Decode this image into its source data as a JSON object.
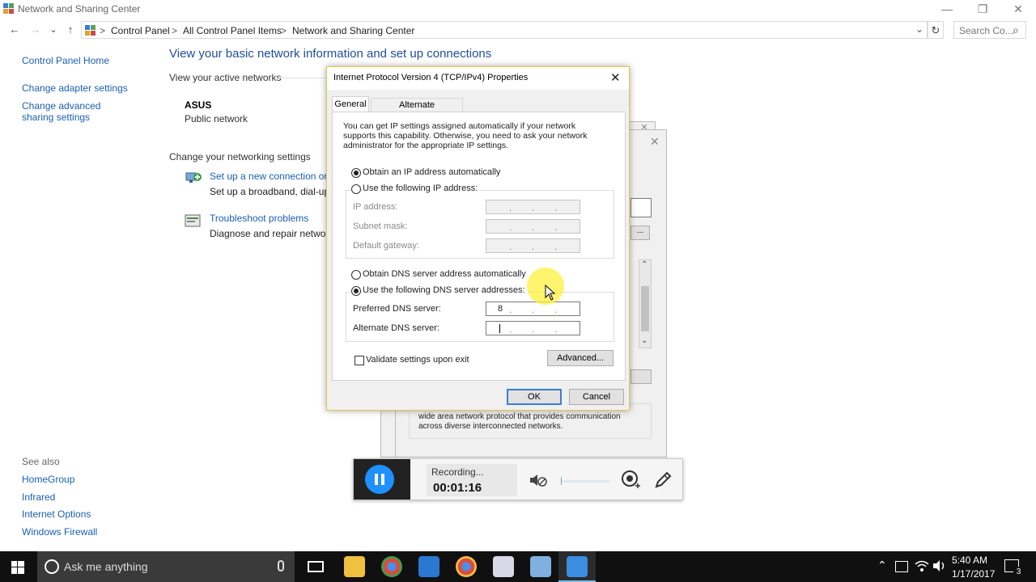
{
  "window": {
    "title": "Network and Sharing Center",
    "minimize": "—",
    "restore": "❐",
    "close": "✕"
  },
  "address": {
    "back": "←",
    "forward": "→",
    "dropdown": "⌄",
    "up": "↑",
    "breadcrumb": [
      "Control Panel",
      "All Control Panel Items",
      "Network and Sharing Center"
    ],
    "separator": ">",
    "refresh": "↻",
    "search_placeholder": "Search Co...",
    "search_icon": "⌕"
  },
  "left_pane": {
    "links": [
      "Control Panel Home",
      "Change adapter settings",
      "Change advanced sharing settings"
    ],
    "see_also_label": "See also",
    "see_also": [
      "HomeGroup",
      "Infrared",
      "Internet Options",
      "Windows Firewall"
    ]
  },
  "main": {
    "heading": "View your basic network information and set up connections",
    "active_networks_label": "View your active networks",
    "network_name": "ASUS",
    "network_type": "Public network",
    "change_settings_label": "Change your networking settings",
    "tasks": [
      {
        "title": "Set up a new connection or n",
        "desc": "Set up a broadband, dial-up,"
      },
      {
        "title": "Troubleshoot problems",
        "desc": "Diagnose and repair network"
      }
    ]
  },
  "back_dialog": {
    "description": "wide area network protocol that provides communication across diverse interconnected networks."
  },
  "dialog": {
    "title": "Internet Protocol Version 4 (TCP/IPv4) Properties",
    "close": "✕",
    "tabs": [
      "General",
      "Alternate Configuration"
    ],
    "intro": "You can get IP settings assigned automatically if your network supports this capability. Otherwise, you need to ask your network administrator for the appropriate IP settings.",
    "ip_auto": "Obtain an IP address automatically",
    "ip_manual": "Use the following IP address:",
    "ip_address_label": "IP address:",
    "subnet_label": "Subnet mask:",
    "gateway_label": "Default gateway:",
    "dns_auto": "Obtain DNS server address automatically",
    "dns_manual": "Use the following DNS server addresses:",
    "preferred_dns_label": "Preferred DNS server:",
    "preferred_dns_value": "8",
    "alternate_dns_label": "Alternate DNS server:",
    "validate_label": "Validate settings upon exit",
    "advanced_button": "Advanced...",
    "ok_button": "OK",
    "cancel_button": "Cancel"
  },
  "recorder": {
    "status": "Recording...",
    "time": "00:01:16"
  },
  "taskbar": {
    "search_placeholder": "Ask me anything",
    "clock_time": "5:40 AM",
    "clock_date": "1/17/2017",
    "notification_count": "3",
    "tray_chevron": "⌃"
  },
  "colors": {
    "link": "#1a5fb4",
    "heading": "#1e4e9c",
    "taskbar": "#101010",
    "recorder_accent": "#1e90ff"
  }
}
